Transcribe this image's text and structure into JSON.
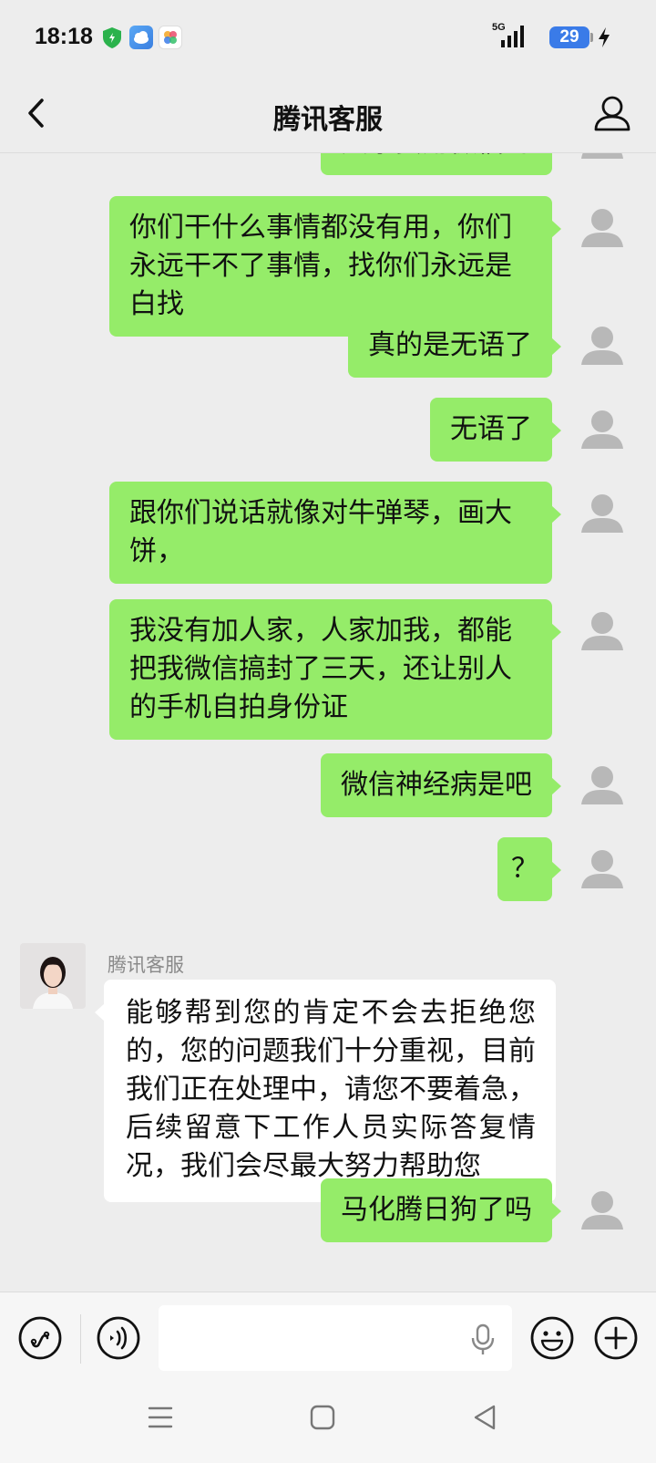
{
  "status_bar": {
    "time": "18:18",
    "network": "5G",
    "battery": "29",
    "icons": [
      "shield-app-icon",
      "weather-app-icon",
      "gallery-app-icon",
      "signal-icon",
      "battery-icon",
      "charging-icon"
    ]
  },
  "header": {
    "title": "腾讯客服",
    "back_icon": "chevron-left-icon",
    "profile_icon": "person-icon"
  },
  "messages": [
    {
      "from": "me",
      "text": "大家要用微信的"
    },
    {
      "from": "me",
      "text": "你们干什么事情都没有用，你们永远干不了事情，找你们永远是白找"
    },
    {
      "from": "me",
      "text": "真的是无语了"
    },
    {
      "from": "me",
      "text": "无语了"
    },
    {
      "from": "me",
      "text": "跟你们说话就像对牛弹琴，画大饼，"
    },
    {
      "from": "me",
      "text": "我没有加人家，人家加我，都能把我微信搞封了三天，还让别人的手机自拍身份证"
    },
    {
      "from": "me",
      "text": "微信神经病是吧"
    },
    {
      "from": "me",
      "text": "？"
    },
    {
      "from": "other",
      "sender": "腾讯客服",
      "text": "能够帮到您的肯定不会去拒绝您的，您的问题我们十分重视，目前我们正在处理中，请您不要着急，后续留意下工作人员实际答复情况，我们会尽最大努力帮助您"
    },
    {
      "from": "me",
      "text": "马化腾日狗了吗"
    }
  ],
  "input_bar": {
    "value": "",
    "placeholder": "",
    "icons": [
      "mini-program-icon",
      "voice-icon",
      "mic-icon",
      "emoji-icon",
      "plus-icon"
    ]
  },
  "nav_bar": {
    "icons": [
      "menu-icon",
      "home-icon",
      "back-triangle-icon"
    ]
  },
  "colors": {
    "background": "#ededed",
    "my_bubble": "#95ec69",
    "other_bubble": "#ffffff",
    "battery": "#3a7be8"
  }
}
